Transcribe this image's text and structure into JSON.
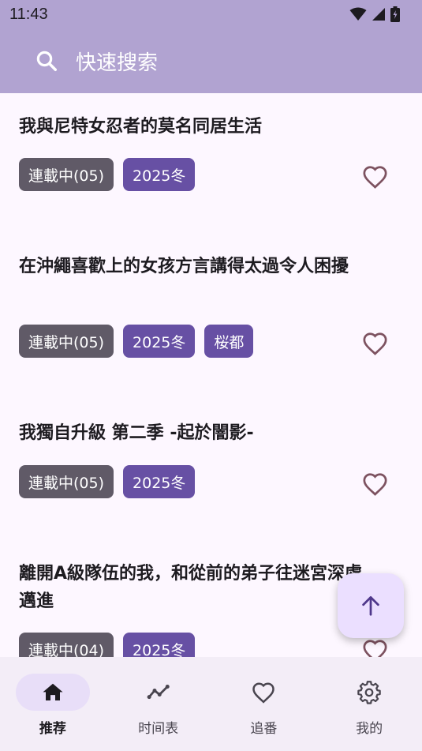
{
  "status_bar": {
    "time": "11:43"
  },
  "search": {
    "placeholder": "快速搜索"
  },
  "items": [
    {
      "title": "我與尼特女忍者的莫名同居生活",
      "tags": [
        "連載中(05)",
        "2025冬"
      ]
    },
    {
      "title": "在沖繩喜歡上的女孩方言講得太過令人困擾",
      "tags": [
        "連載中(05)",
        "2025冬",
        "桜都"
      ]
    },
    {
      "title": "我獨自升級 第二季 -起於闇影-",
      "tags": [
        "連載中(05)",
        "2025冬"
      ]
    },
    {
      "title": "離開A級隊伍的我，和從前的弟子往迷宮深處邁進",
      "tags": [
        "連載中(04)",
        "2025冬"
      ]
    }
  ],
  "nav": [
    {
      "label": "推荐",
      "icon": "home-icon",
      "active": true
    },
    {
      "label": "时间表",
      "icon": "timeline-icon",
      "active": false
    },
    {
      "label": "追番",
      "icon": "heart-icon",
      "active": false
    },
    {
      "label": "我的",
      "icon": "settings-icon",
      "active": false
    }
  ],
  "colors": {
    "header": "#b1a3d1",
    "background": "#fdf7ff",
    "status_tag": "#605a67",
    "season_tag": "#6750a4",
    "heart": "#7d5260",
    "fab": "#ebdfff",
    "nav_bg": "#f3edf7",
    "nav_active_pill": "#e8def8"
  }
}
